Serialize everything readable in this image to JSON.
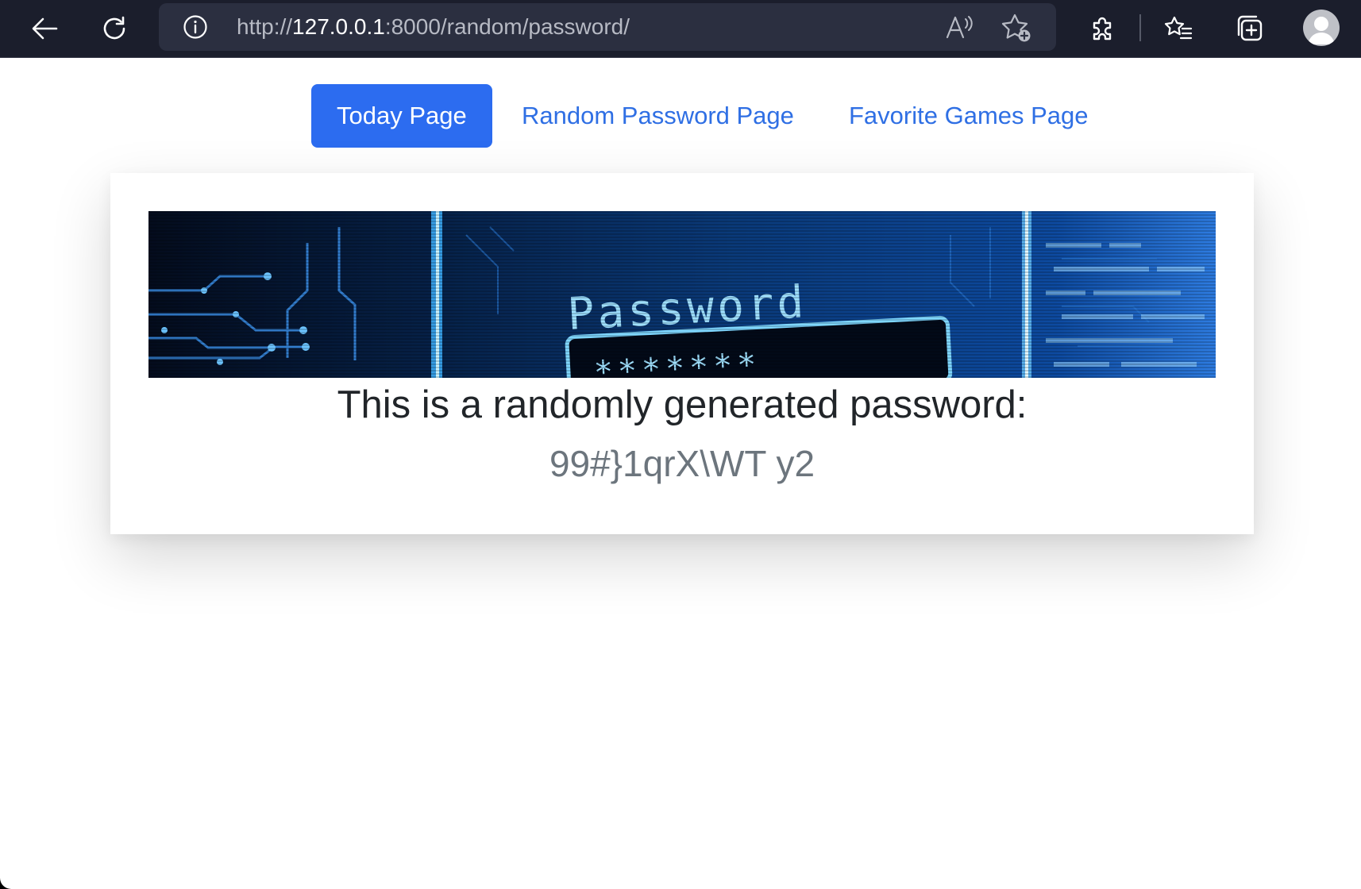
{
  "browser": {
    "url_scheme": "http://",
    "url_host": "127.0.0.1",
    "url_rest": ":8000/random/password/"
  },
  "nav": {
    "items": [
      {
        "label": "Today Page",
        "active": true
      },
      {
        "label": "Random Password Page",
        "active": false
      },
      {
        "label": "Favorite Games Page",
        "active": false
      }
    ]
  },
  "card": {
    "banner_alt": "Password",
    "title": "This is a randomly generated password:",
    "password": "99#}1qrX\\WT y2"
  },
  "icons": {
    "back": "back-arrow-icon",
    "refresh": "refresh-icon",
    "info": "info-icon",
    "read_aloud": "read-aloud-icon",
    "add_favorite": "add-favorite-star-icon",
    "extensions": "puzzle-icon",
    "favorites": "favorites-list-icon",
    "collections": "collections-icon",
    "profile": "profile-avatar-icon"
  },
  "colors": {
    "chrome_bg": "#1b1e2c",
    "address_bg": "#2b2f40",
    "accent": "#2c6cf0",
    "link": "#2f6fe4",
    "title_text": "#212529",
    "password_text": "#6c757d"
  }
}
